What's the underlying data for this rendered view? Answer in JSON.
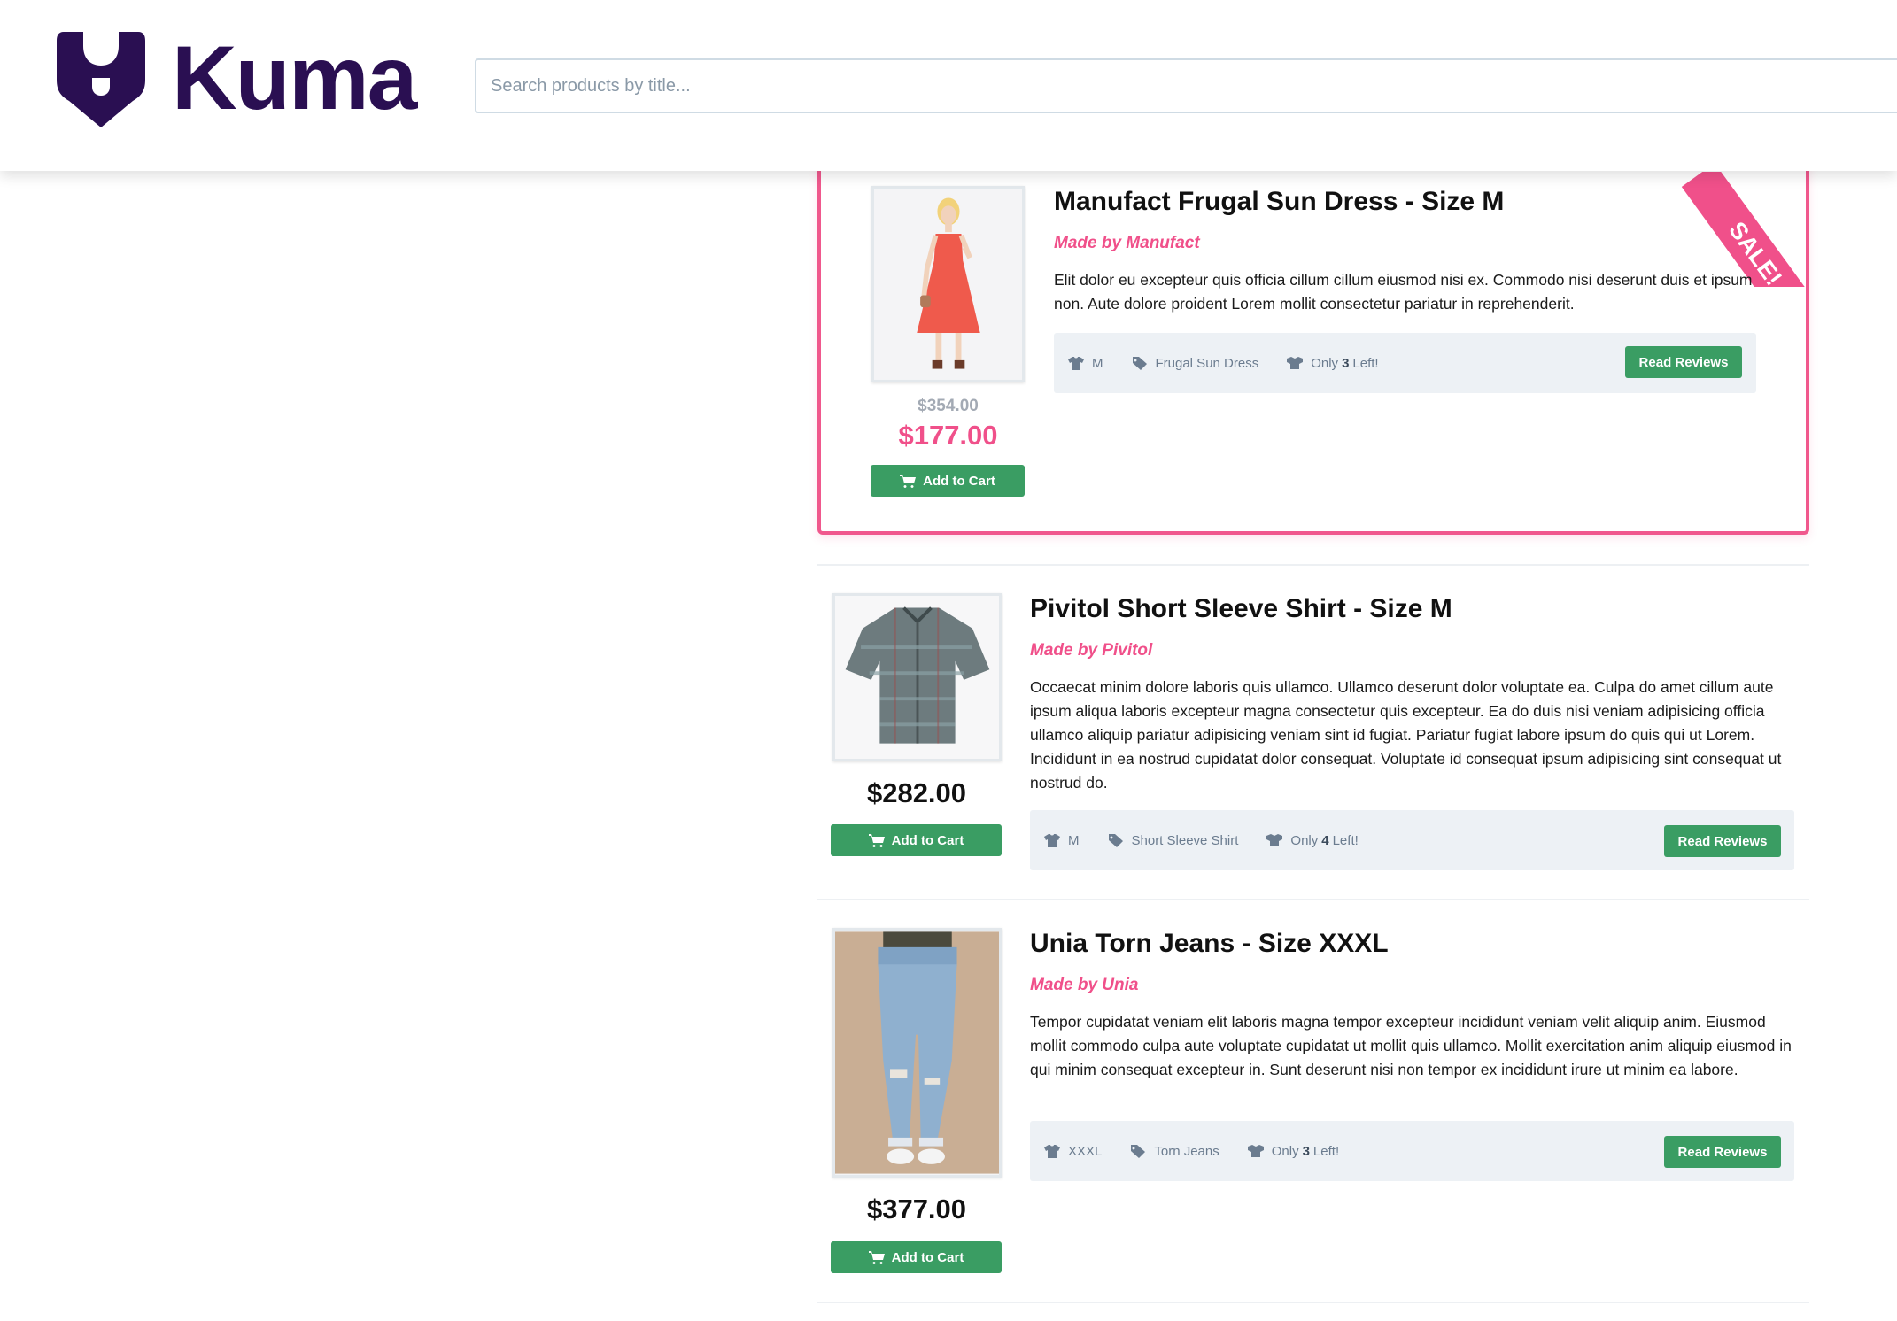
{
  "brand": {
    "name": "Kuma"
  },
  "search": {
    "placeholder": "Search products by title..."
  },
  "products": [
    {
      "title": "Manufact Frugal Sun Dress - Size M",
      "maker": "Made by Manufact",
      "description": "Elit dolor eu excepteur quis officia cillum cillum eiusmod nisi ex. Commodo nisi deserunt duis et ipsum non. Aute dolore proident Lorem mollit consectetur pariatur in reprehenderit.",
      "size": "M",
      "tag": "Frugal Sun Dress",
      "stock_prefix": "Only",
      "stock_count": "3",
      "stock_suffix": "Left!",
      "reviews_label": "Read Reviews",
      "old_price": "$354.00",
      "price": "$177.00",
      "cart_label": "Add to Cart",
      "sale_label": "SALE!"
    },
    {
      "title": "Pivitol Short Sleeve Shirt - Size M",
      "maker": "Made by Pivitol",
      "description": "Occaecat minim dolore laboris quis ullamco. Ullamco deserunt dolor voluptate ea. Culpa do amet cillum aute ipsum aliqua laboris excepteur magna consectetur quis excepteur. Ea do duis nisi veniam adipisicing officia ullamco aliquip pariatur adipisicing veniam sint id fugiat. Pariatur fugiat labore ipsum do quis qui ut Lorem. Incididunt in ea nostrud cupidatat dolor consequat. Voluptate id consequat ipsum adipisicing sint consequat ut nostrud do.",
      "size": "M",
      "tag": "Short Sleeve Shirt",
      "stock_prefix": "Only",
      "stock_count": "4",
      "stock_suffix": "Left!",
      "reviews_label": "Read Reviews",
      "price": "$282.00",
      "cart_label": "Add to Cart"
    },
    {
      "title": "Unia Torn Jeans - Size XXXL",
      "maker": "Made by Unia",
      "description": "Tempor cupidatat veniam elit laboris magna tempor excepteur incididunt veniam velit aliquip anim. Eiusmod mollit commodo culpa aute voluptate cupidatat ut mollit quis ullamco. Mollit exercitation anim aliquip eiusmod in qui minim consequat excepteur in. Sunt deserunt nisi non tempor ex incididunt irure ut minim ea labore.",
      "size": "XXXL",
      "tag": "Torn Jeans",
      "stock_prefix": "Only",
      "stock_count": "3",
      "stock_suffix": "Left!",
      "reviews_label": "Read Reviews",
      "price": "$377.00",
      "cart_label": "Add to Cart"
    }
  ],
  "colors": {
    "brand": "#2a0f52",
    "accent_pink": "#f0508a",
    "button_green": "#3a9d63",
    "meta_bg": "#edf1f5"
  },
  "icons": {
    "size": "tshirt-icon",
    "tag": "tag-icon",
    "stock": "boxes-icon",
    "cart": "cart-icon"
  }
}
